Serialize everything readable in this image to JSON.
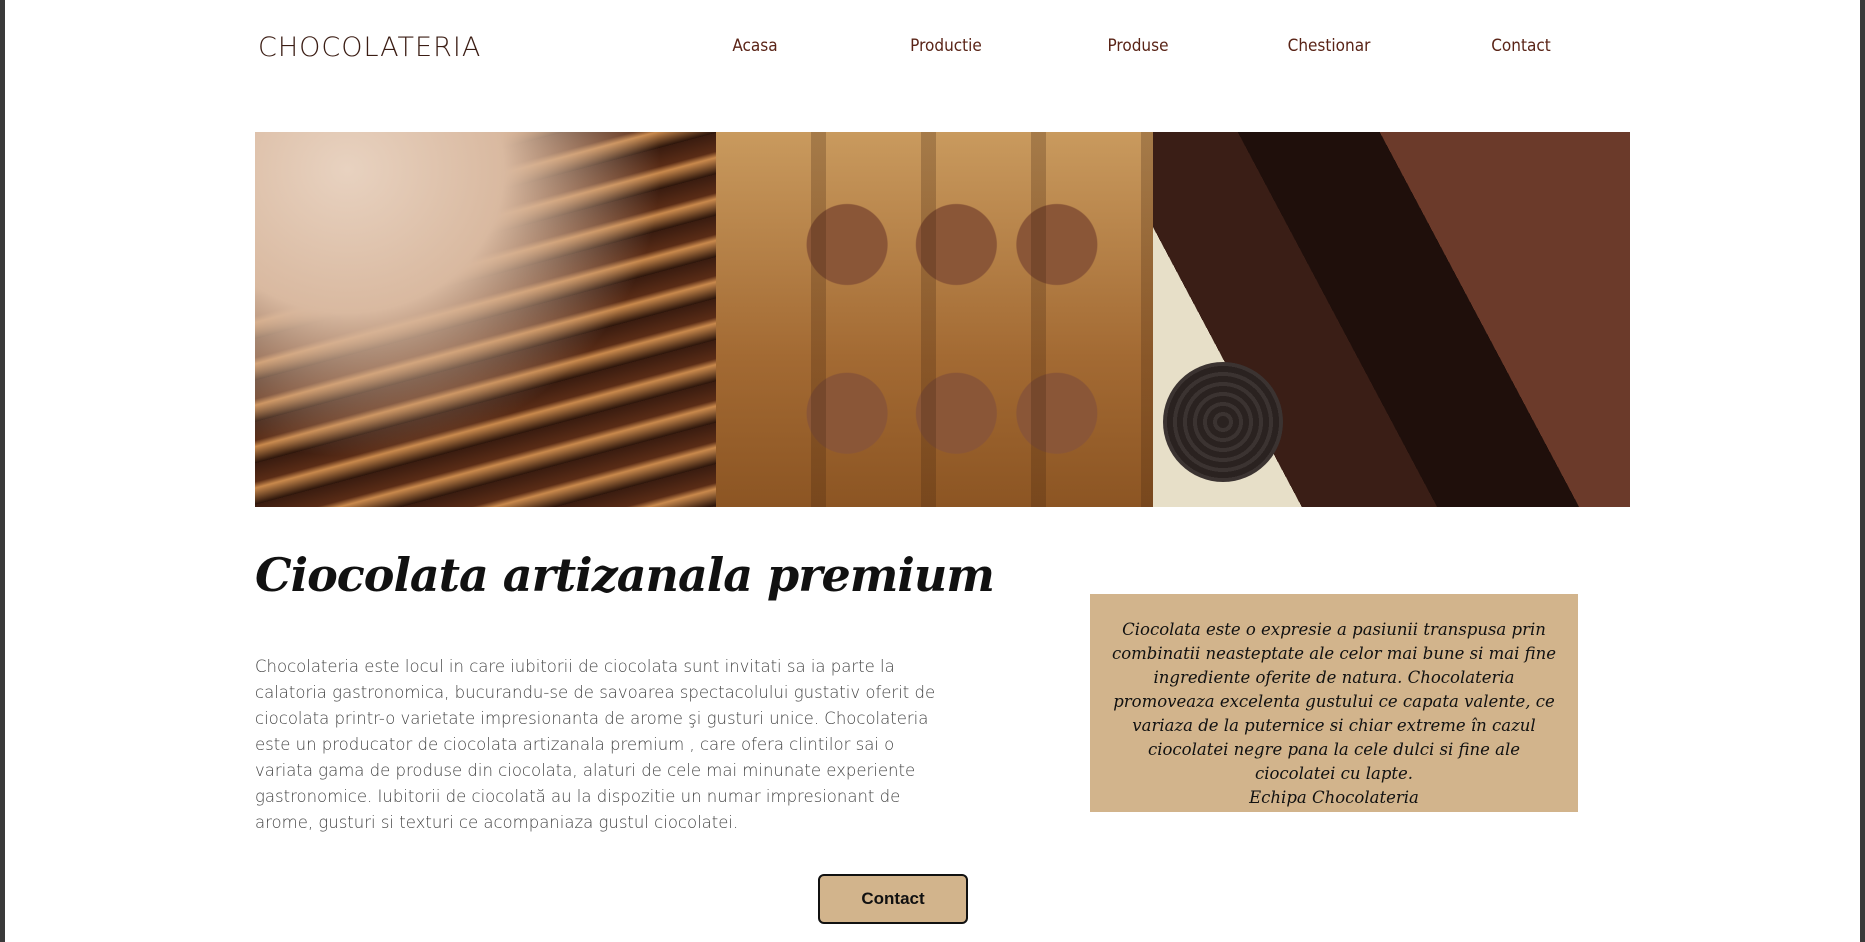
{
  "header": {
    "brand": "CHOCOLATERIA",
    "nav": [
      {
        "label": "Acasa"
      },
      {
        "label": "Productie"
      },
      {
        "label": "Produse"
      },
      {
        "label": "Chestionar"
      },
      {
        "label": "Contact"
      }
    ]
  },
  "hero": {
    "images": [
      {
        "name": "chocolate-pretzels-image"
      },
      {
        "name": "chocolate-squares-image"
      },
      {
        "name": "chocolate-bars-image"
      }
    ]
  },
  "main": {
    "title": "Ciocolata artizanala premium",
    "description": "Chocolateria este locul in care iubitorii de ciocolata sunt invitati sa ia parte la calatoria gastronomica, bucurandu-se de savoarea spectacolului gustativ oferit de ciocolata printr-o varietate impresionanta de arome şi gusturi unice. Chocolateria este un producator de ciocolata artizanala premium , care ofera clintilor sai o variata gama de produse din ciocolata, alaturi de cele mai minunate experiente gastronomice. Iubitorii de ciocolată au la dispozitie un numar impresionant de arome, gusturi si texturi ce acompaniaza gustul ciocolatei."
  },
  "quote": {
    "text": "Ciocolata este o expresie a pasiunii transpusa prin combinatii neasteptate ale celor mai bune si mai fine ingrediente oferite de natura. Chocolateria promoveaza excelenta gustului ce capata valente, ce variaza de la puternice si chiar extreme în cazul ciocolatei negre pana la cele dulci si fine ale ciocolatei cu lapte.",
    "signature": "Echipa Chocolateria"
  },
  "cta": {
    "label": "Contact"
  },
  "colors": {
    "accent": "#d2b48c",
    "nav_text": "#5a2417",
    "brand_text": "#3b1d14"
  }
}
